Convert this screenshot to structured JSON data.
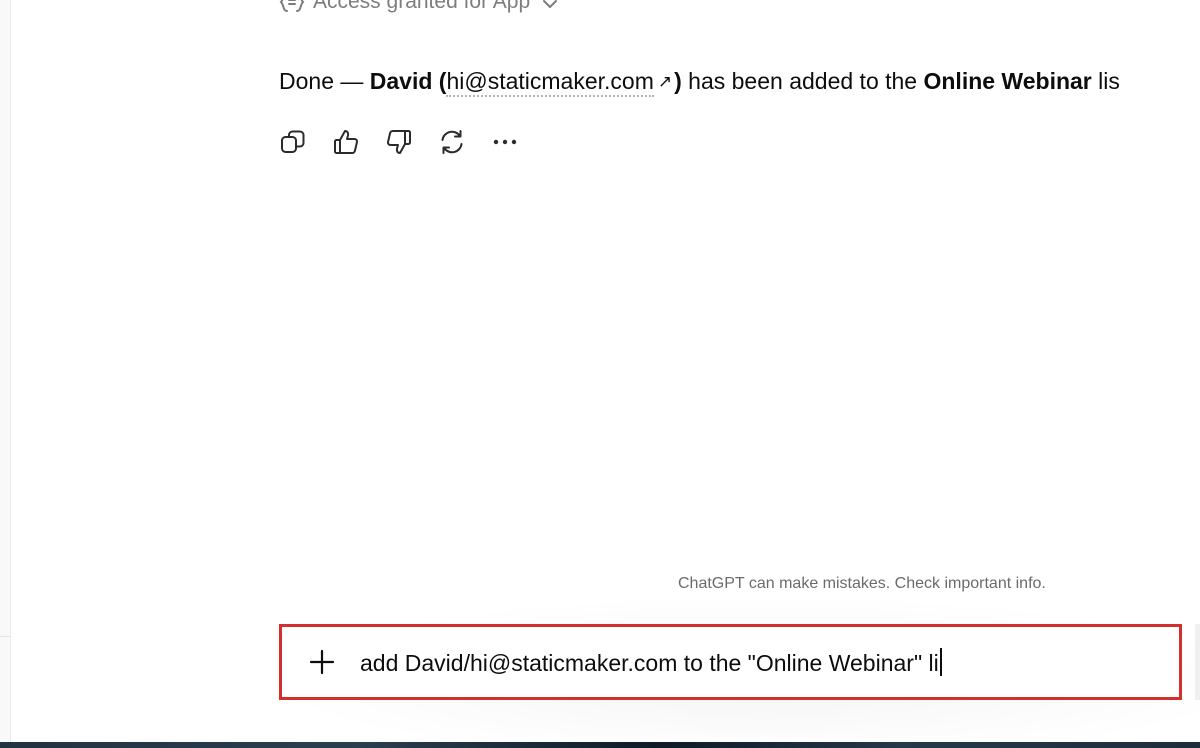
{
  "tool_call": {
    "label": "Access granted for App",
    "icon": "code-braces-icon",
    "toggle_icon": "chevron-down-icon"
  },
  "assistant_message": {
    "prefix": "Done — ",
    "name": "David (",
    "email": "hi@staticmaker.com",
    "external_icon": "↗",
    "name_close": ")",
    "middle": " has been added to the ",
    "list_name": "Online Webinar",
    "suffix": " lis"
  },
  "message_actions": [
    {
      "name": "copy-button",
      "icon": "copy-icon"
    },
    {
      "name": "thumbs-up-button",
      "icon": "thumbs-up-icon"
    },
    {
      "name": "thumbs-down-button",
      "icon": "thumbs-down-icon"
    },
    {
      "name": "regenerate-button",
      "icon": "refresh-icon"
    },
    {
      "name": "more-options-button",
      "icon": "more-horizontal-icon"
    }
  ],
  "disclaimer": "ChatGPT can make mistakes. Check important info.",
  "composer": {
    "attach_icon": "plus-icon",
    "value": "add David/hi@staticmaker.com to the \"Online Webinar\" li"
  },
  "colors": {
    "highlight_border": "#d32f2f",
    "muted_text": "#6b6b6b",
    "body_text": "#0d0d0d"
  }
}
